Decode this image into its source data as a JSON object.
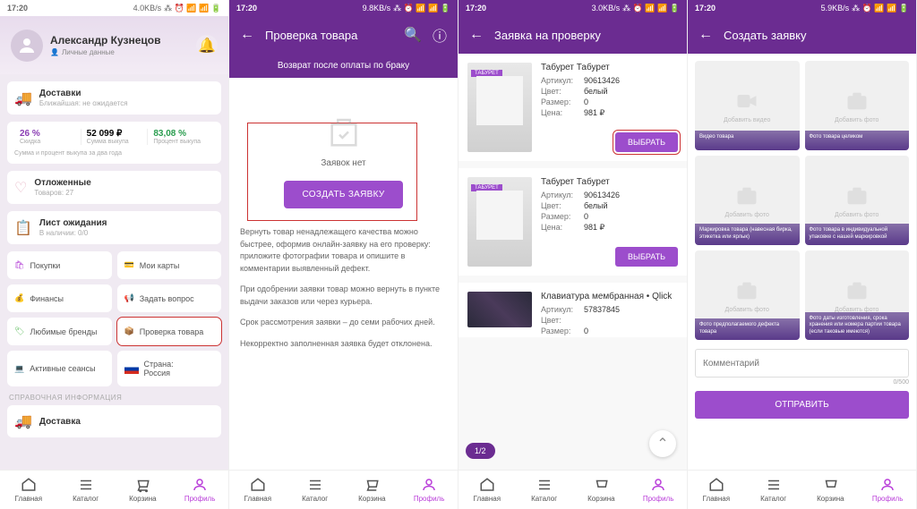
{
  "statusbar": {
    "time": "17:20",
    "speeds": [
      "4.0KB/s",
      "9.8KB/s",
      "3.0KB/s",
      "5.9KB/s"
    ]
  },
  "s1": {
    "user_name": "Александр Кузнецов",
    "user_sub": "Личные данные",
    "delivery": {
      "title": "Доставки",
      "sub": "Ближайшая: не ожидается"
    },
    "stats": [
      {
        "val": "26 %",
        "lbl": "Скидка"
      },
      {
        "val": "52 099 ₽",
        "lbl": "Сумма выкупа"
      },
      {
        "val": "83,08 %",
        "lbl": "Процент выкупа"
      }
    ],
    "stats_note": "Сумма и процент выкупа за два года",
    "deferred": {
      "title": "Отложенные",
      "sub": "Товаров: 27"
    },
    "waitlist": {
      "title": "Лист ожидания",
      "sub": "В наличии: 0/0"
    },
    "cells": {
      "purchases": "Покупки",
      "cards": "Мои карты",
      "finance": "Финансы",
      "ask": "Задать вопрос",
      "brands": "Любимые бренды",
      "check": "Проверка товара",
      "sessions": "Активные сеансы",
      "country_lbl": "Страна:",
      "country": "Россия"
    },
    "section": "СПРАВОЧНАЯ ИНФОРМАЦИЯ",
    "help_delivery": "Доставка"
  },
  "s2": {
    "title": "Проверка товара",
    "tab": "Возврат после оплаты по браку",
    "empty": "Заявок нет",
    "create_btn": "СОЗДАТЬ ЗАЯВКУ",
    "info1": "Вернуть товар ненадлежащего качества можно быстрее, оформив онлайн-заявку на его проверку: приложите фотографии товара и опишите в комментарии выявленный дефект.",
    "info2": "При одобрении заявки товар можно вернуть в пункте выдачи заказов или через курьера.",
    "info3": "Срок рассмотрения заявки – до семи рабочих дней.",
    "info4": "Некорректно заполненная заявка будет отклонена."
  },
  "s3": {
    "title": "Заявка на проверку",
    "products": [
      {
        "name": "Табурет Табурет",
        "tag": "ТАБУРЕТ",
        "art": "90613426",
        "color": "белый",
        "size": "0",
        "price": "981 ₽"
      },
      {
        "name": "Табурет Табурет",
        "tag": "ТАБУРЕТ",
        "art": "90613426",
        "color": "белый",
        "size": "0",
        "price": "981 ₽"
      },
      {
        "name": "Клавиатура мембранная • Qlick",
        "art": "57837845",
        "size": "0"
      }
    ],
    "labels": {
      "art": "Артикул:",
      "color": "Цвет:",
      "size": "Размер:",
      "price": "Цена:"
    },
    "select_btn": "ВЫБРАТЬ",
    "pager": "1/2"
  },
  "s4": {
    "title": "Создать заявку",
    "tiles": [
      {
        "lbl": "Добавить видео",
        "desc": "Видео товара",
        "type": "video"
      },
      {
        "lbl": "Добавить фото",
        "desc": "Фото товара целиком",
        "type": "photo"
      },
      {
        "lbl": "Добавить фото",
        "desc": "Маркировка товара (навесная бирка, этикетка или ярлык)",
        "type": "photo"
      },
      {
        "lbl": "Добавить фото",
        "desc": "Фото товара в индивидуальной упаковке с нашей маркировкой",
        "type": "photo"
      },
      {
        "lbl": "Добавить фото",
        "desc": "Фото предполагаемого дефекта товара",
        "type": "photo"
      },
      {
        "lbl": "Добавить фото",
        "desc": "Фото даты изготовления, срока хранения или номера партии товара (если таковые имеются)",
        "type": "photo"
      }
    ],
    "comment_ph": "Комментарий",
    "char": "0/500",
    "send": "ОТПРАВИТЬ"
  },
  "tabs": {
    "home": "Главная",
    "catalog": "Каталог",
    "cart": "Корзина",
    "profile": "Профиль"
  }
}
